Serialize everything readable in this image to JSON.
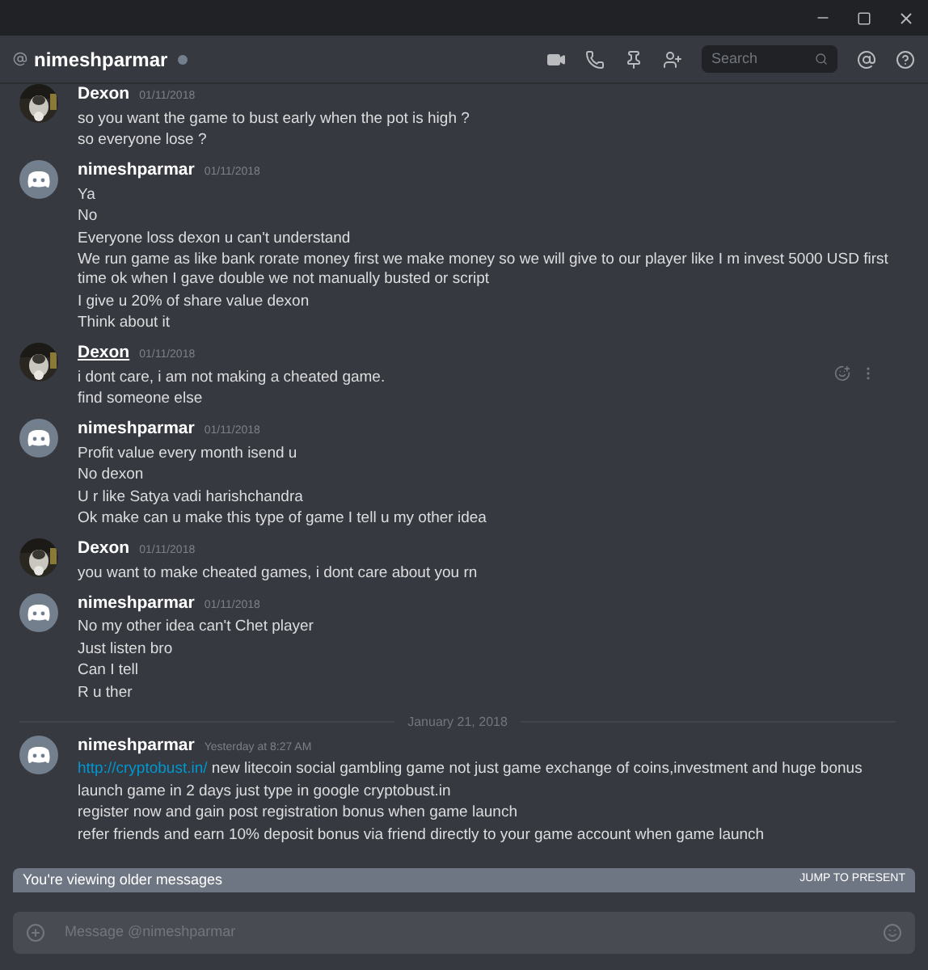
{
  "header": {
    "title": "nimeshparmar",
    "search": {
      "placeholder": "Search"
    }
  },
  "messages": [
    {
      "author": "Dexon",
      "underlined": false,
      "time": "01/11/2018",
      "lines": [
        "so you want the game to bust early when the pot is high ?",
        "so everyone lose ?"
      ]
    },
    {
      "author": "nimeshparmar",
      "kind": "default",
      "underlined": false,
      "time": "01/11/2018",
      "lines": [
        "Ya",
        "No",
        "Everyone loss dexon u can't understand",
        "We run game as like bank rorate money first we make money so we will give to our player like I m invest 5000 USD first time ok when I gave double we not manually busted or script",
        "I give u 20% of share value dexon",
        "Think about it"
      ]
    },
    {
      "author": "Dexon",
      "underlined": true,
      "time": "01/11/2018",
      "hovered": true,
      "lines": [
        "i dont care, i am not making a cheated game.",
        "find someone else"
      ]
    },
    {
      "author": "nimeshparmar",
      "kind": "default",
      "underlined": false,
      "time": "01/11/2018",
      "lines": [
        "Profit value every month isend u",
        "No dexon",
        "U r like Satya vadi harishchandra",
        "Ok make can u make this type of game I tell u my other idea"
      ]
    },
    {
      "author": "Dexon",
      "underlined": false,
      "time": "01/11/2018",
      "lines": [
        "you want to make cheated games, i dont care about you rn"
      ]
    },
    {
      "author": "nimeshparmar",
      "kind": "default",
      "underlined": false,
      "time": "01/11/2018",
      "lines": [
        "No my other idea can't Chet player",
        "Just listen bro",
        "Can I tell",
        "R u ther"
      ]
    },
    {
      "divider": "January 21, 2018"
    },
    {
      "author": "nimeshparmar",
      "kind": "default",
      "underlined": false,
      "time": "Yesterday at 8:27 AM",
      "link": "http://cryptobust.in/",
      "lines": [
        "new litecoin social gambling game not just game exchange of coins,investment and huge bonus",
        "launch game in 2 days just type in google cryptobust.in",
        "register now and gain post registration bonus when game launch",
        "refer friends and earn 10% deposit bonus via friend directly to your game account when game launch"
      ]
    }
  ],
  "older_bar": {
    "text": "You're viewing older messages",
    "action": "JUMP TO PRESENT"
  },
  "composer": {
    "placeholder": "Message @nimeshparmar"
  }
}
